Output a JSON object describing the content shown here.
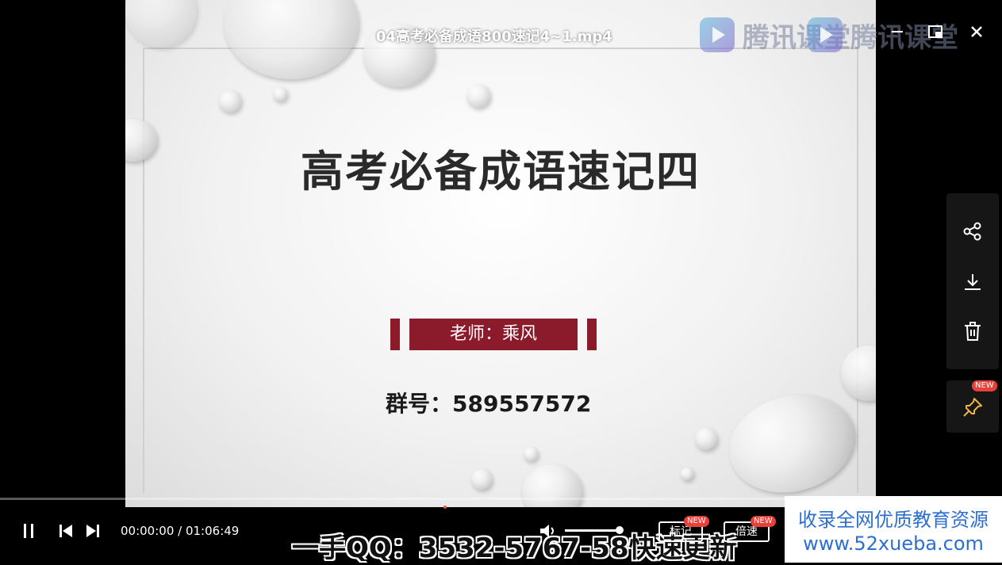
{
  "video": {
    "file_title": "04高考必备成语800速记4~1.mp4",
    "slide_title": "高考必备成语速记四",
    "teacher": "老师：乘风",
    "group_label": "群号：",
    "group_number": "589557572"
  },
  "watermark": {
    "brand_text": "腾讯课堂"
  },
  "window_controls": {
    "minimize_icon": "minimize-icon",
    "pip_icon": "picture-in-picture-icon",
    "close_icon": "close-icon"
  },
  "side_actions": [
    {
      "icon": "share-icon"
    },
    {
      "icon": "download-icon"
    },
    {
      "icon": "trash-icon"
    }
  ],
  "pin": {
    "badge": "NEW"
  },
  "player": {
    "current_time": "00:00:00",
    "separator": " / ",
    "duration": "01:06:49",
    "progress": 0.0,
    "volume": 0.9,
    "mark_button": "标记",
    "speed_button": "倍速",
    "new_badge": "NEW"
  },
  "overlay": {
    "qq_banner": "一手QQ：3532-5767-58快速更新"
  },
  "promo": {
    "line1": "收录全网优质教育资源",
    "line2": "www.52xueba.com"
  },
  "colors": {
    "accent_red": "#8b1a2b",
    "promo_blue": "#2d6fd0",
    "badge_red": "#e8413b"
  }
}
